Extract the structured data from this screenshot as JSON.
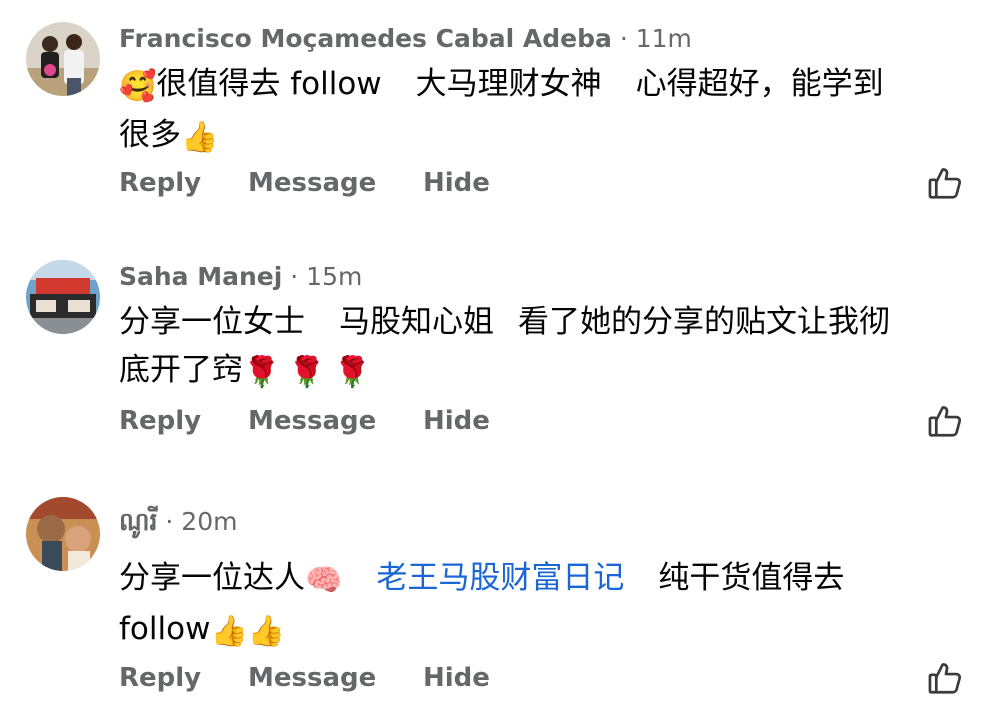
{
  "comments": [
    {
      "author": "Francisco Moçamedes Cabal Adeba",
      "time": "· 11m",
      "line1_a": "很值得去 follow",
      "line1_b": "大马理财女神",
      "line1_c": "心得超好，能学到",
      "line2": "很多",
      "emoji_start": "smiling-face-with-hearts-icon",
      "emoji_end": "thumbs-up-icon"
    },
    {
      "author": "Saha Manej",
      "time": "· 15m",
      "line1_a": "分享一位女士",
      "line1_b": "马股知心姐",
      "line1_c": "看了她的分享的贴文让我彻",
      "line2": "底开了窍",
      "emoji_end": "rose-icon"
    },
    {
      "author": "ណូរី",
      "time": "· 20m",
      "line1_a": "分享一位达人",
      "link": "老王马股财富日记",
      "line1_c": "纯干货值得去",
      "line2": "follow",
      "emoji_mid": "brain-icon",
      "emoji_end": "thumbs-up-icon"
    }
  ],
  "actions": {
    "reply": "Reply",
    "message": "Message",
    "hide": "Hide"
  },
  "colors": {
    "meta": "#65676b",
    "link": "#1a66d6",
    "text": "#050505"
  }
}
